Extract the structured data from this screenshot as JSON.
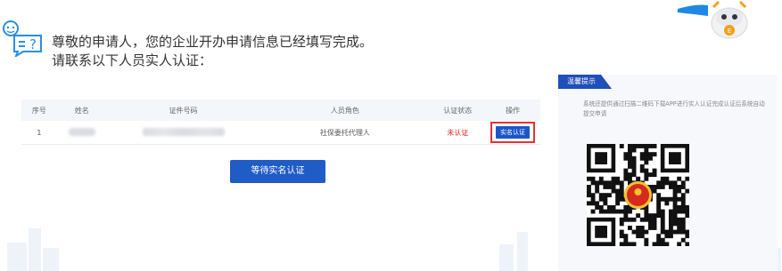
{
  "notice": {
    "line1": "尊敬的申请人，您的企业开办申请信息已经填写完成。",
    "line2": "请联系以下人员实人认证："
  },
  "table": {
    "headers": [
      "序号",
      "姓名",
      "证件号码",
      "人员角色",
      "认证状态",
      "操作"
    ],
    "rows": [
      {
        "no": "1",
        "role": "社保委托代理人",
        "status": "未认证",
        "action": "实名认证"
      }
    ]
  },
  "wait_button": "等待实名认证",
  "tip_panel": {
    "title": "温馨提示",
    "text": "系统还提供通过扫描二维码下载APP进行实人认证完成认证后系统自动提交申请"
  },
  "colors": {
    "primary": "#1f5cc6",
    "status_unverified": "#e02020",
    "highlight_border": "#e63232"
  },
  "icons": {
    "notice": "chat-question-icon",
    "mascot": "robot-mascot-icon",
    "qr": "qr-code-icon"
  }
}
